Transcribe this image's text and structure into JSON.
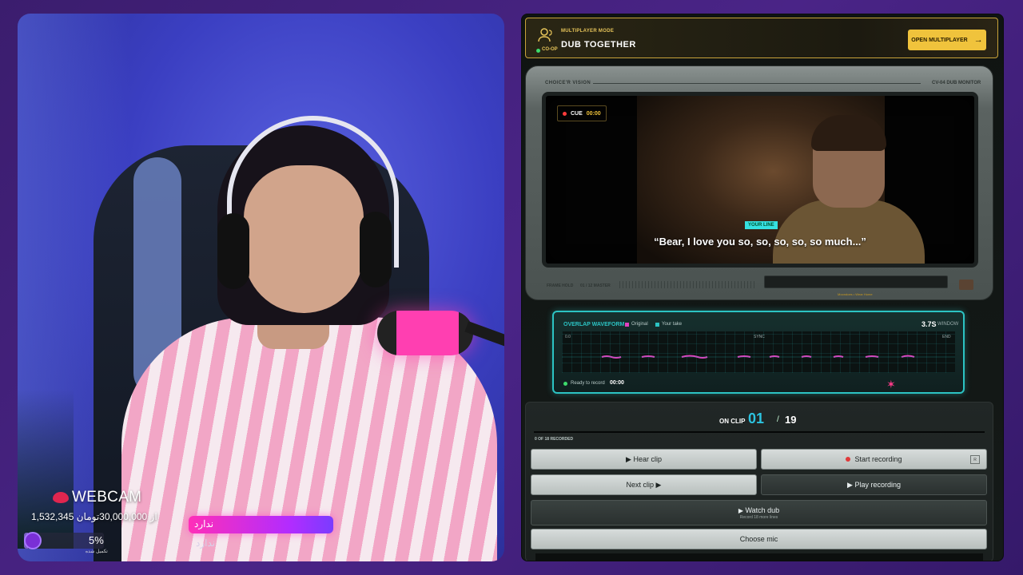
{
  "webcam": {
    "title": "WEBCAM",
    "donate_line": "1,532,345 از 30,000,000تومان",
    "progress_pct": 5,
    "progress_label": "5%",
    "progress_sub": "تکمیل شده",
    "alert_text": "ندارد",
    "alert_sub": "ندارد",
    "icon": "lips-icon"
  },
  "multiplayer": {
    "kicker": "MULTIPLAYER MODE",
    "title": "DUB TOGETHER",
    "online": "CO-OP",
    "button_label": "OPEN MULTIPLAYER",
    "button_icon": "arrow-right-icon",
    "accent": "#f0c33c"
  },
  "monitor": {
    "label_left": "CHOICE'R VISION",
    "label_right": "CV-04 DUB MONITOR",
    "cue_label": "CUE",
    "cue_time": "00:00",
    "your_line_tag": "YOUR LINE",
    "subtitle": "“Bear, I love you so, so, so, so, so much...”",
    "frame_hold": "FRAME HOLD",
    "master": "01 / 12 MASTER",
    "track_caption": "Moondoes • Wear Home"
  },
  "waveform": {
    "title": "OVERLAP WAVEFORM",
    "legend_original": "Original",
    "legend_take": "Your take",
    "window_value": "3.7S",
    "window_label": "WINDOW",
    "axis_left": "0.0",
    "axis_mid": "SYNC",
    "axis_right": "END",
    "status": "Ready to record",
    "status_time": "00:00",
    "colors": {
      "original": "#e040c0",
      "take": "#2cc3c3"
    }
  },
  "controls": {
    "on_clip_label": "ON CLIP",
    "clip_current": "01",
    "clip_separator": "/",
    "clip_total": "19",
    "recorded": "0 OF 18 RECORDED",
    "hear_clip": "▶ Hear clip",
    "start_recording": "Start recording",
    "record_key": "R",
    "next_clip": "Next clip ▶",
    "play_recording": "▶ Play recording",
    "watch_dub": "Watch dub",
    "watch_dub_sub": "Record 18 more lines",
    "choose_mic": "Choose mic"
  }
}
